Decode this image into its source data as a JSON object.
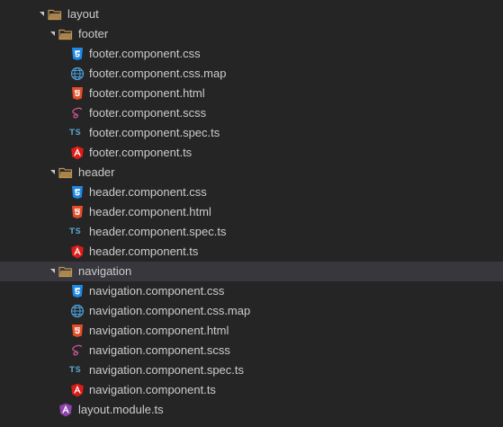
{
  "explorer": {
    "items": [
      {
        "label": "layout",
        "kind": "folder",
        "depth": 1,
        "expanded": true
      },
      {
        "label": "footer",
        "kind": "folder",
        "depth": 2,
        "expanded": true
      },
      {
        "label": "footer.component.css",
        "kind": "css",
        "depth": 3
      },
      {
        "label": "footer.component.css.map",
        "kind": "map",
        "depth": 3
      },
      {
        "label": "footer.component.html",
        "kind": "html",
        "depth": 3
      },
      {
        "label": "footer.component.scss",
        "kind": "scss",
        "depth": 3
      },
      {
        "label": "footer.component.spec.ts",
        "kind": "ts",
        "depth": 3
      },
      {
        "label": "footer.component.ts",
        "kind": "angular",
        "depth": 3
      },
      {
        "label": "header",
        "kind": "folder",
        "depth": 2,
        "expanded": true
      },
      {
        "label": "header.component.css",
        "kind": "css",
        "depth": 3
      },
      {
        "label": "header.component.html",
        "kind": "html",
        "depth": 3
      },
      {
        "label": "header.component.spec.ts",
        "kind": "ts",
        "depth": 3
      },
      {
        "label": "header.component.ts",
        "kind": "angular",
        "depth": 3
      },
      {
        "label": "navigation",
        "kind": "folder",
        "depth": 2,
        "expanded": true,
        "selected": true
      },
      {
        "label": "navigation.component.css",
        "kind": "css",
        "depth": 3
      },
      {
        "label": "navigation.component.css.map",
        "kind": "map",
        "depth": 3
      },
      {
        "label": "navigation.component.html",
        "kind": "html",
        "depth": 3
      },
      {
        "label": "navigation.component.scss",
        "kind": "scss",
        "depth": 3
      },
      {
        "label": "navigation.component.spec.ts",
        "kind": "ts",
        "depth": 3
      },
      {
        "label": "navigation.component.ts",
        "kind": "angular",
        "depth": 3
      },
      {
        "label": "layout.module.ts",
        "kind": "angular-module",
        "depth": 2
      }
    ]
  },
  "icons": {
    "folder": "folder-open-icon",
    "css": "css3-icon",
    "map": "source-map-globe-icon",
    "html": "html5-icon",
    "scss": "sass-icon",
    "ts": "typescript-icon",
    "angular": "angular-icon",
    "angular-module": "angular-module-icon"
  },
  "colors": {
    "background": "#252526",
    "selected_row": "#37373d",
    "text": "#cccccc",
    "folder": "#c09553",
    "css": "#1e88e5",
    "html": "#e44d26",
    "scss": "#c6538c",
    "ts": "#519aba",
    "angular": "#dd1b16",
    "map": "#4a9fd8"
  }
}
